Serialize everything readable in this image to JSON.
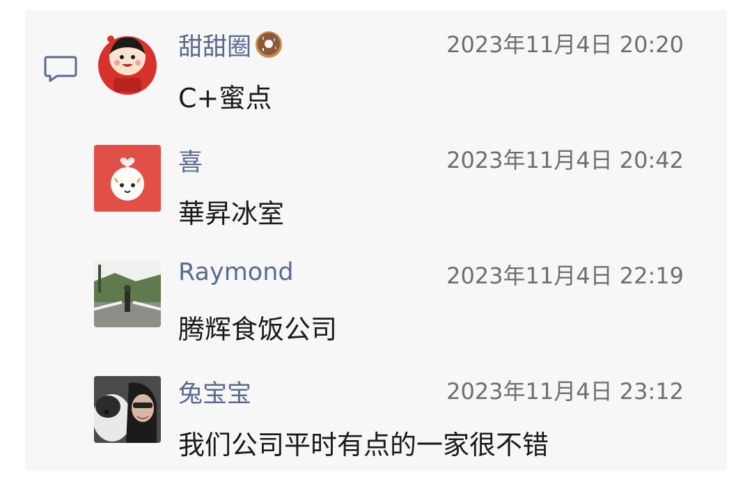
{
  "comments": [
    {
      "user": "甜甜圈",
      "time": "2023年11月4日 20:20",
      "text": "C+蜜点",
      "avatar": "cartoon-girl-red"
    },
    {
      "user": "喜",
      "time": "2023年11月4日 20:42",
      "text": "華昇冰室",
      "avatar": "cartoon-tiger"
    },
    {
      "user": "Raymond",
      "time": "2023年11月4日 22:19",
      "text": "腾辉食饭公司",
      "avatar": "photo-walkway"
    },
    {
      "user": "兔宝宝",
      "time": "2023年11月4日 23:12",
      "text": "我们公司平时有点的一家很不错",
      "avatar": "photo-dog-and-person"
    }
  ],
  "icons": {
    "comment": "comment-bubble-icon",
    "donut_emoji": "donut-emoji-icon"
  },
  "colors": {
    "name": "#5b6a91",
    "time": "#6e6e6e",
    "message": "#1a1a1a",
    "panel_bg": "#f7f7f7"
  }
}
